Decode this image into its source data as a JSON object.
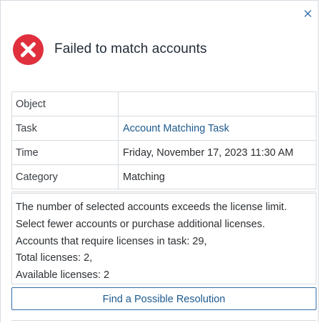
{
  "dialog": {
    "title": "Failed to match accounts",
    "close_icon": "close-icon",
    "status_icon": "error-icon",
    "colors": {
      "error": "#e02f3d",
      "link": "#1d5a8e",
      "button_border": "#2f6ea8"
    }
  },
  "details": {
    "rows": [
      {
        "label": "Object",
        "value": ""
      },
      {
        "label": "Task",
        "value": "Account Matching Task"
      },
      {
        "label": "Time",
        "value": "Friday, November 17, 2023 11:30 AM"
      },
      {
        "label": "Category",
        "value": "Matching"
      }
    ]
  },
  "message": {
    "lines": [
      "The number of selected accounts exceeds the license limit.",
      "Select fewer accounts or purchase additional licenses.",
      "Accounts that require licenses in task: 29,",
      "Total licenses: 2,",
      "Available licenses: 2"
    ]
  },
  "actions": {
    "resolve_label": "Find a Possible Resolution"
  }
}
